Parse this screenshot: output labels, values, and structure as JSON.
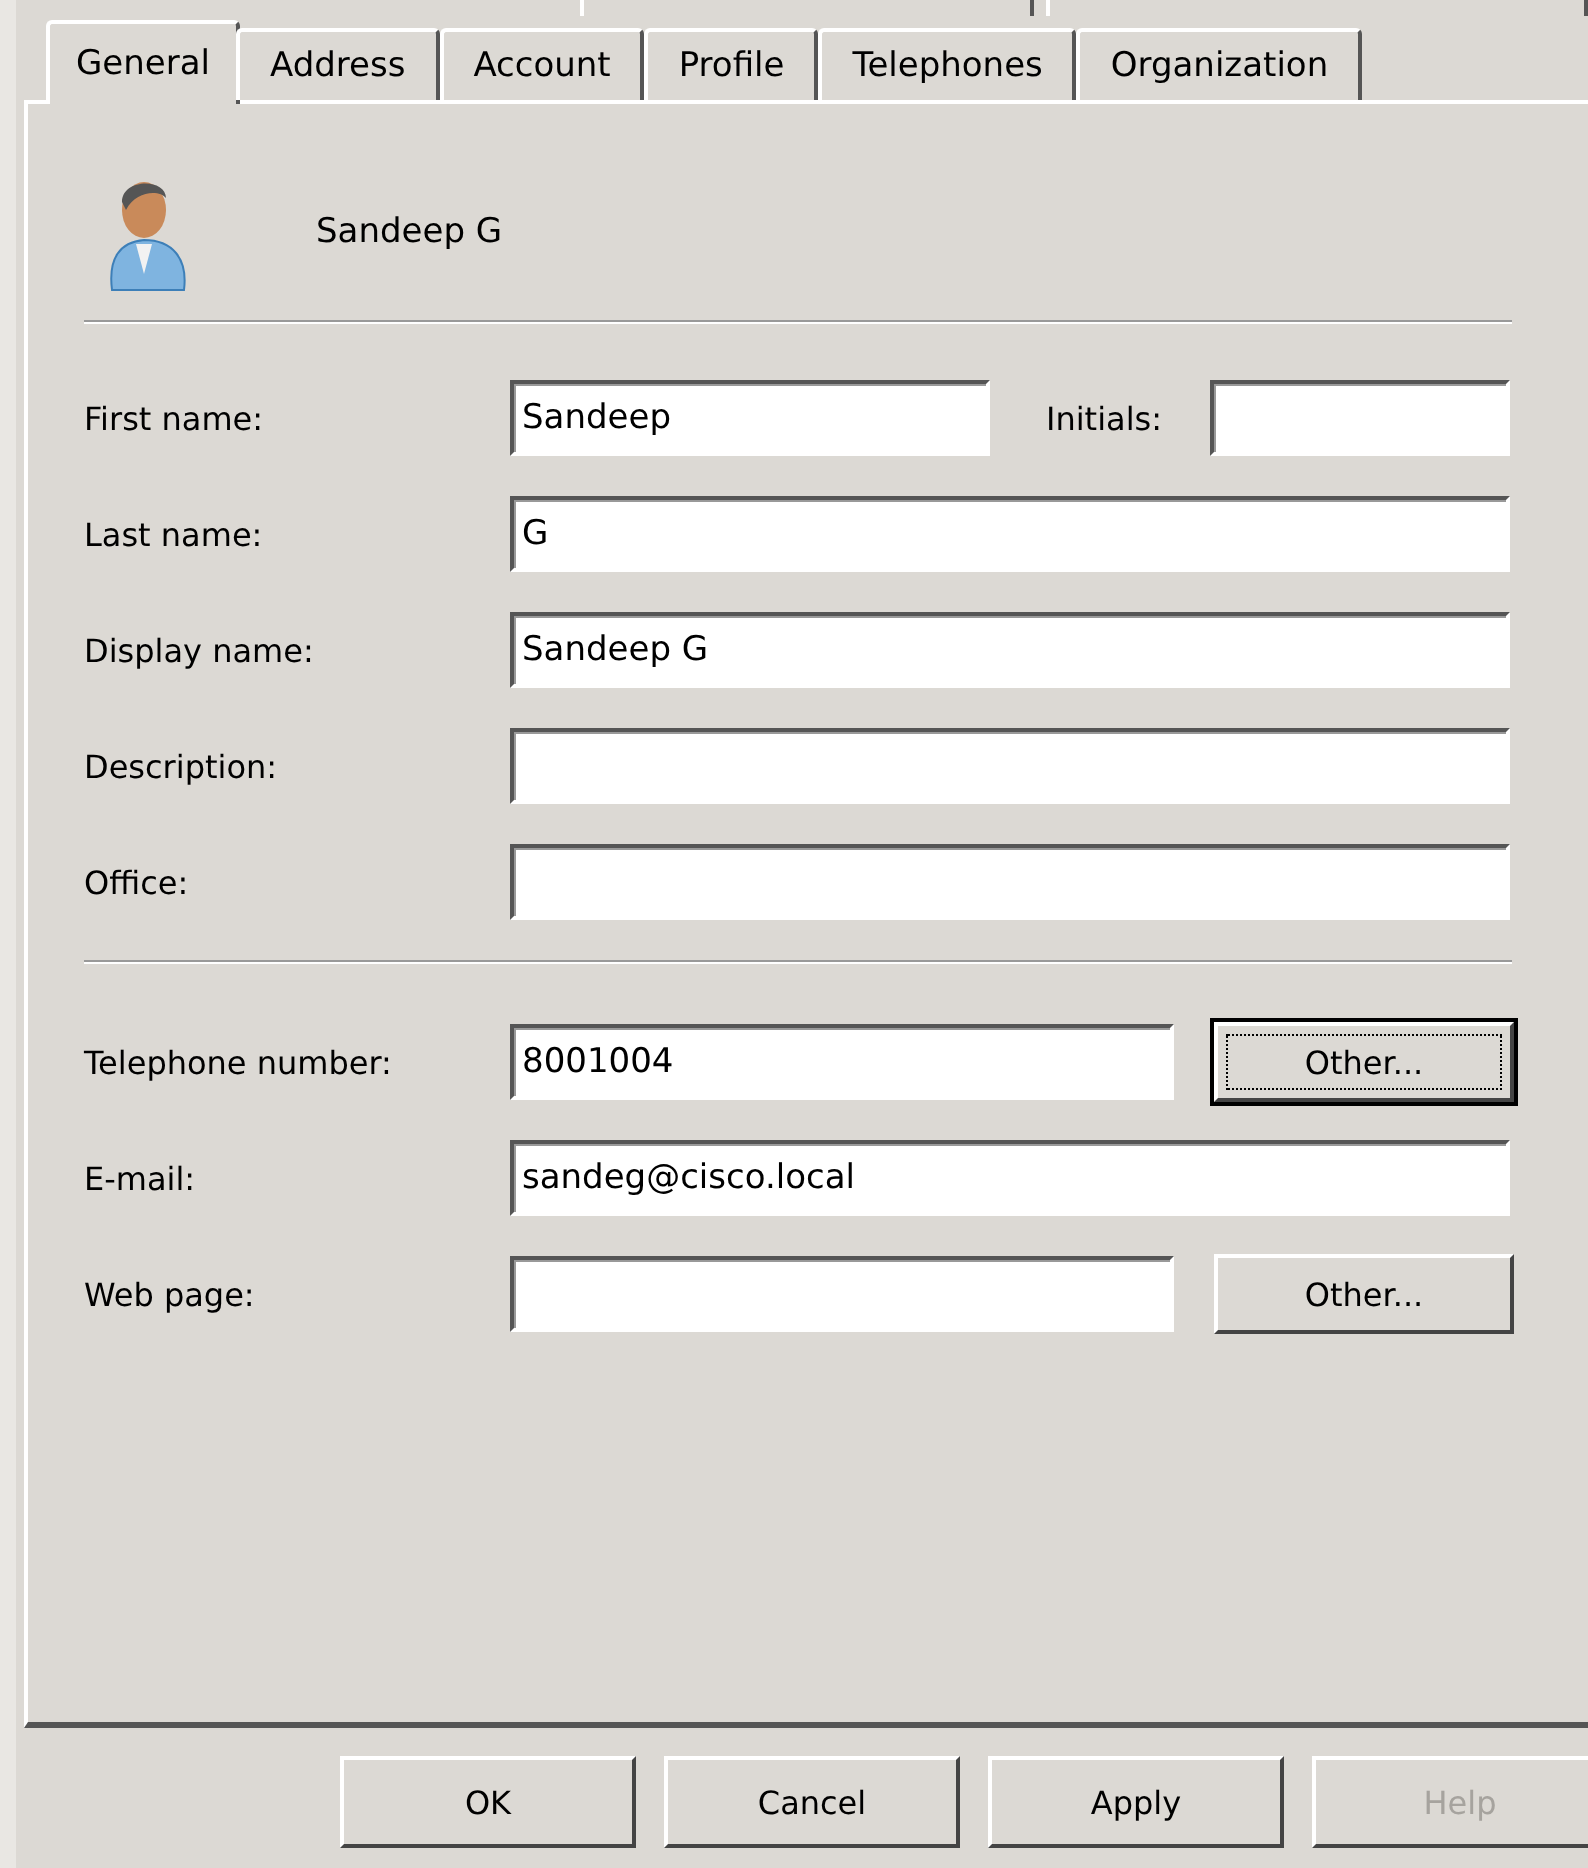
{
  "tabs": [
    {
      "label": "General",
      "selected": true
    },
    {
      "label": "Address",
      "selected": false
    },
    {
      "label": "Account",
      "selected": false
    },
    {
      "label": "Profile",
      "selected": false
    },
    {
      "label": "Telephones",
      "selected": false
    },
    {
      "label": "Organization",
      "selected": false
    }
  ],
  "header": {
    "name": "Sandeep G"
  },
  "name_fields": [
    {
      "label": "First name:",
      "value": "Sandeep",
      "side": {
        "label": "Initials:"
      }
    },
    {
      "label": "Last name:",
      "value": "G"
    },
    {
      "label": "Display name:",
      "value": "Sandeep G"
    },
    {
      "label": "Description:"
    },
    {
      "label": "Office:"
    }
  ],
  "contact_fields": [
    {
      "label": "Telephone number:",
      "value": "8001004",
      "button": {
        "label": "Other...",
        "focused": true
      }
    },
    {
      "label": "E-mail:",
      "value": "sandeg@cisco.local"
    },
    {
      "label": "Web page:",
      "button": {
        "label": "Other...",
        "focused": false
      }
    }
  ],
  "buttons": [
    {
      "label": "OK",
      "disabled": false
    },
    {
      "label": "Cancel",
      "disabled": false
    },
    {
      "label": "Apply",
      "disabled": false
    },
    {
      "label": "Help",
      "disabled": true
    }
  ]
}
